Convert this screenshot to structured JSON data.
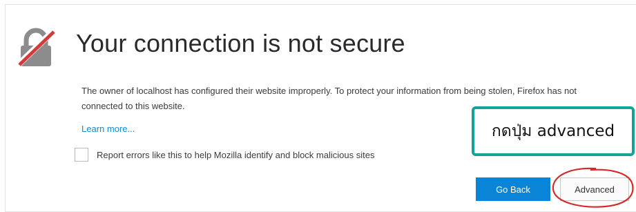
{
  "page": {
    "title": "Your connection is not secure",
    "description": "The owner of localhost has configured their website improperly. To protect your information from being stolen, Firefox has not connected to this website.",
    "learn_more": "Learn more...",
    "report_checkbox_label": "Report errors like this to help Mozilla identify and block malicious sites",
    "report_checkbox_checked": false
  },
  "buttons": {
    "go_back": "Go Back",
    "advanced": "Advanced"
  },
  "annotation": {
    "callout_text": "กดปุ่ม advanced",
    "callout_border_color": "#12a596",
    "circle_color": "#d42a2a"
  },
  "icons": {
    "lock": "broken-lock-icon"
  },
  "colors": {
    "primary_button": "#0a84d6",
    "link": "#0a8dd6",
    "lock_strike": "#d43a3a",
    "lock_body": "#8c8c8c"
  }
}
